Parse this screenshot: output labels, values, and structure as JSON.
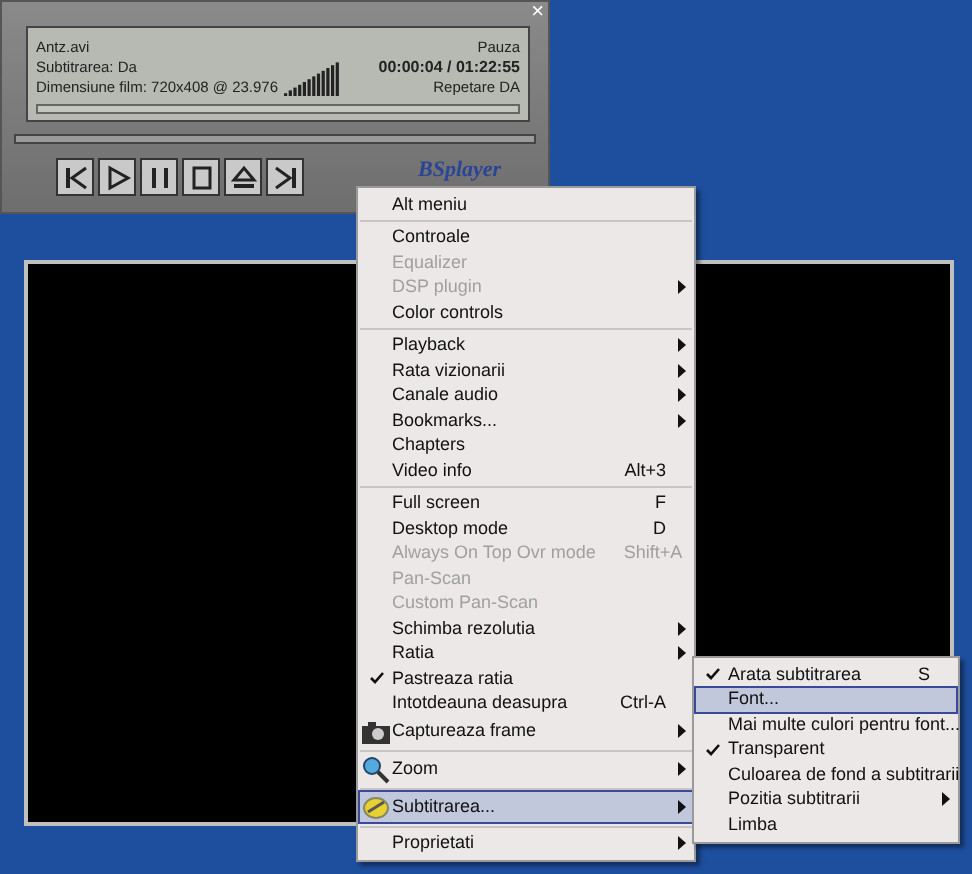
{
  "player": {
    "file": "Antz.avi",
    "state": "Pauza",
    "subtitle": "Subtitrarea: Da",
    "time": "00:00:04 / 01:22:55",
    "dimensions": "Dimensiune film: 720x408 @ 23.976",
    "repeat": "Repetare DA",
    "close": "×",
    "buttons": [
      {
        "kind": "prev"
      },
      {
        "kind": "play"
      },
      {
        "kind": "pause"
      },
      {
        "kind": "stop"
      },
      {
        "kind": "eject"
      },
      {
        "kind": "next"
      }
    ],
    "logo": "BSplayer"
  },
  "menu": [
    {
      "kind": "item",
      "label": "Alt meniu"
    },
    {
      "kind": "separator"
    },
    {
      "kind": "item",
      "label": "Controale"
    },
    {
      "kind": "item",
      "label": "Equalizer",
      "disabled": true
    },
    {
      "kind": "item",
      "label": "DSP plugin",
      "disabled": true,
      "submenu": true
    },
    {
      "kind": "item",
      "label": "Color controls"
    },
    {
      "kind": "separator"
    },
    {
      "kind": "item",
      "label": "Playback",
      "submenu": true
    },
    {
      "kind": "item",
      "label": "Rata vizionarii",
      "submenu": true
    },
    {
      "kind": "item",
      "label": "Canale audio",
      "submenu": true
    },
    {
      "kind": "item",
      "label": "Bookmarks...",
      "submenu": true
    },
    {
      "kind": "item",
      "label": "Chapters"
    },
    {
      "kind": "item",
      "label": "Video info",
      "shortcut": "Alt+3"
    },
    {
      "kind": "separator"
    },
    {
      "kind": "item",
      "label": "Full screen",
      "shortcut": "F"
    },
    {
      "kind": "item",
      "label": "Desktop mode",
      "shortcut": "D"
    },
    {
      "kind": "item",
      "label": "Always On Top Ovr mode",
      "shortcut": "Shift+A",
      "disabled": true
    },
    {
      "kind": "item",
      "label": "Pan-Scan",
      "disabled": true
    },
    {
      "kind": "item",
      "label": "Custom Pan-Scan",
      "disabled": true
    },
    {
      "kind": "item",
      "label": "Schimba rezolutia",
      "submenu": true
    },
    {
      "kind": "item",
      "label": "Ratia",
      "submenu": true
    },
    {
      "kind": "item",
      "label": "Pastreaza ratia",
      "checked": true
    },
    {
      "kind": "item",
      "label": "Intotdeauna deasupra",
      "shortcut": "Ctrl-A"
    },
    {
      "kind": "camera",
      "label": "Captureaza frame",
      "submenu": true
    },
    {
      "kind": "separator"
    },
    {
      "kind": "magnifier",
      "label": "Zoom",
      "submenu": true
    },
    {
      "kind": "separator"
    },
    {
      "kind": "subtitle",
      "label": "Subtitrarea...",
      "submenu": true,
      "selected": true
    },
    {
      "kind": "separator"
    },
    {
      "kind": "item",
      "label": "Proprietati",
      "submenu": true
    }
  ],
  "submenu": [
    {
      "kind": "item",
      "label": "Arata subtitrarea",
      "shortcut": "S",
      "checked": true
    },
    {
      "kind": "item",
      "label": "Font...",
      "selected": true
    },
    {
      "kind": "item",
      "label": "Mai multe culori pentru font..."
    },
    {
      "kind": "item",
      "label": "Transparent",
      "checked": true
    },
    {
      "kind": "item",
      "label": "Culoarea de fond a subtitrarii"
    },
    {
      "kind": "item",
      "label": "Pozitia subtitrarii",
      "submenu": true
    },
    {
      "kind": "item",
      "label": "Limba"
    }
  ]
}
